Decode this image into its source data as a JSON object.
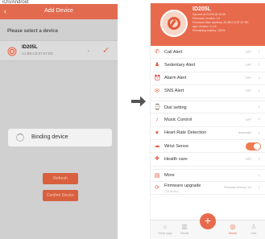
{
  "caption": "iOS/Android",
  "left": {
    "header_title": "Add Device",
    "back_glyph": "‹",
    "subtitle": "Please select a device",
    "device": {
      "name": "ID205L",
      "mac": "A1:B0:C3:97:07:DE",
      "signal_glyph": "⋆",
      "check_glyph": "✓"
    },
    "dialog_text": "Binding device",
    "refresh_label": "Refresh",
    "confirm_label": "Confirm Device"
  },
  "right": {
    "device": {
      "name": "ID205L",
      "lines": [
        "Synced at 01/09/18 16:09",
        "Firmware version: V4",
        "Firmware Mac address: A1:B0:C3:97:07:DE",
        "App Version: 3.1.8",
        "Remaining battery: 100%"
      ]
    },
    "rows": [
      {
        "icon": "✆",
        "label": "Call Alert",
        "value": "OFF",
        "gap": false
      },
      {
        "icon": "♟",
        "label": "Sedentary Alert",
        "value": "OFF",
        "gap": false
      },
      {
        "icon": "⏰",
        "label": "Alarm Alert",
        "value": "OFF",
        "gap": false
      },
      {
        "icon": "✉",
        "label": "SNS Alert",
        "value": "OFF",
        "gap": false
      },
      {
        "icon": "⌚",
        "label": "Dial setting",
        "value": "",
        "gap": true
      },
      {
        "icon": "♪",
        "label": "Music Control",
        "value": "OFF",
        "gap": false
      },
      {
        "icon": "♥",
        "label": "Heart Rate Detection",
        "value": "Automatic",
        "gap": false
      },
      {
        "icon": "☁",
        "label": "Wrist Sense",
        "value": "",
        "toggle": true,
        "gap": false
      },
      {
        "icon": "✚",
        "label": "Health care",
        "value": "OFF",
        "gap": false
      },
      {
        "icon": "▤",
        "label": "More",
        "value": "",
        "gap": true
      },
      {
        "icon": "⟳",
        "label": "Firmware upgrade",
        "sub": "7.01.01.04.1",
        "value": "Firmware version: V4",
        "gap": false
      }
    ],
    "tabs": [
      {
        "icon": "⌂",
        "label": "Home page"
      },
      {
        "icon": "▥",
        "label": "Details"
      },
      {
        "icon": "◎",
        "label": "Device"
      },
      {
        "icon": "♙",
        "label": "User"
      }
    ],
    "add_glyph": "+"
  }
}
